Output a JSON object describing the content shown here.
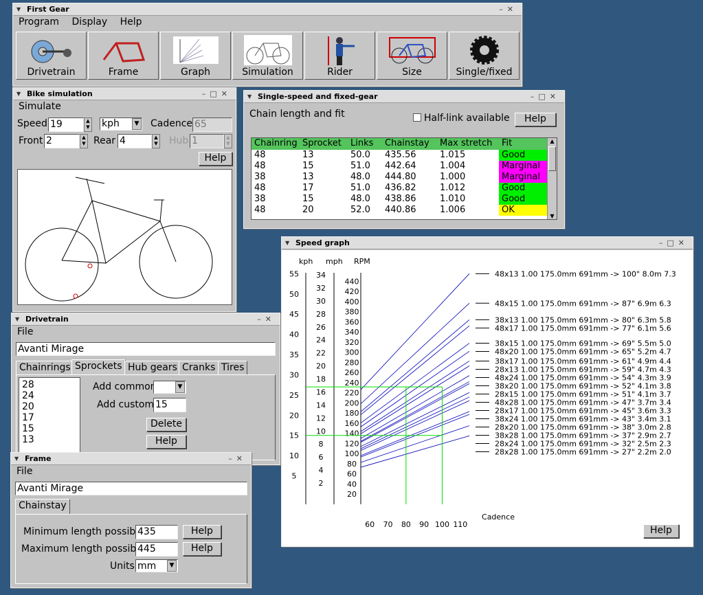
{
  "first_gear": {
    "title": "First Gear",
    "menu": [
      "Program",
      "Display",
      "Help"
    ],
    "toolbar": [
      {
        "label": "Drivetrain",
        "icon": "drivetrain-icon"
      },
      {
        "label": "Frame",
        "icon": "frame-icon"
      },
      {
        "label": "Graph",
        "icon": "graph-icon"
      },
      {
        "label": "Simulation",
        "icon": "simulation-icon"
      },
      {
        "label": "Rider",
        "icon": "rider-icon"
      },
      {
        "label": "Size",
        "icon": "size-icon"
      },
      {
        "label": "Single/fixed",
        "icon": "gear-icon"
      }
    ]
  },
  "bike_sim": {
    "title": "Bike simulation",
    "menu": "Simulate",
    "speed_label": "Speed",
    "speed": "19",
    "unit": "kph",
    "cadence_label": "Cadence",
    "cadence": "65",
    "front_label": "Front",
    "front": "2",
    "rear_label": "Rear",
    "rear": "4",
    "hub_label": "Hub",
    "hub": "1",
    "help": "Help"
  },
  "single_speed": {
    "title": "Single-speed and fixed-gear",
    "subtitle": "Chain length and fit",
    "halflink": "Half-link available",
    "help": "Help",
    "columns": [
      "Chainring",
      "Sprocket",
      "Links",
      "Chainstay",
      "Max stretch",
      "Fit"
    ],
    "rows": [
      [
        "48",
        "13",
        "50.0",
        "435.56",
        "1.015",
        "Good"
      ],
      [
        "48",
        "15",
        "51.0",
        "442.64",
        "1.004",
        "Marginal"
      ],
      [
        "38",
        "13",
        "48.0",
        "444.80",
        "1.000",
        "Marginal"
      ],
      [
        "48",
        "17",
        "51.0",
        "436.82",
        "1.012",
        "Good"
      ],
      [
        "38",
        "15",
        "48.0",
        "438.86",
        "1.010",
        "Good"
      ],
      [
        "48",
        "20",
        "52.0",
        "440.86",
        "1.006",
        "OK"
      ]
    ],
    "fit_colors": {
      "Good": "#00ee00",
      "Marginal": "#ff00ff",
      "OK": "#ffff00"
    }
  },
  "drivetrain": {
    "title": "Drivetrain",
    "menu": "File",
    "name": "Avanti Mirage",
    "tabs": [
      "Chainrings",
      "Sprockets",
      "Hub gears",
      "Cranks",
      "Tires"
    ],
    "active_tab": "Sprockets",
    "sprockets": [
      "28",
      "24",
      "20",
      "17",
      "15",
      "13"
    ],
    "add_common": "Add common",
    "add_custom": "Add custom",
    "custom_value": "15",
    "delete": "Delete",
    "help": "Help"
  },
  "frame": {
    "title": "Frame",
    "menu": "File",
    "name": "Avanti Mirage",
    "tab": "Chainstay",
    "min_label": "Minimum length possible",
    "min": "435",
    "max_label": "Maximum length possible",
    "max": "445",
    "units_label": "Units",
    "units": "mm",
    "help": "Help"
  },
  "speed_graph": {
    "title": "Speed graph",
    "axis_kph": "kph",
    "axis_mph": "mph",
    "axis_rpm": "RPM",
    "xlabel": "Cadence",
    "help": "Help",
    "kph_ticks": [
      "55",
      "50",
      "45",
      "40",
      "35",
      "30",
      "25",
      "20",
      "15",
      "10",
      "5"
    ],
    "mph_ticks": [
      "34",
      "32",
      "30",
      "28",
      "26",
      "24",
      "22",
      "20",
      "18",
      "16",
      "14",
      "12",
      "10",
      "8",
      "6",
      "4",
      "2"
    ],
    "rpm_ticks": [
      "440",
      "420",
      "400",
      "380",
      "360",
      "340",
      "320",
      "300",
      "280",
      "260",
      "240",
      "220",
      "200",
      "180",
      "160",
      "140",
      "120",
      "100",
      "80",
      "60",
      "40",
      "20"
    ],
    "cadence_ticks": [
      "60",
      "70",
      "80",
      "90",
      "100",
      "110"
    ]
  },
  "chart_data": {
    "type": "line",
    "xlabel": "Cadence",
    "xlim": [
      55,
      115
    ],
    "ylim_kph": [
      0,
      60
    ],
    "series": [
      {
        "name": "48x13 1.00 175.0mm 691mm -> 100\" 8.0m 7.3",
        "gear": "48x13",
        "kph_at_115": 55.0
      },
      {
        "name": "48x15 1.00 175.0mm 691mm -> 87\" 6.9m 6.3",
        "gear": "48x15",
        "kph_at_115": 47.7
      },
      {
        "name": "38x13 1.00 175.0mm 691mm -> 80\" 6.3m 5.8",
        "gear": "38x13",
        "kph_at_115": 43.6
      },
      {
        "name": "48x17 1.00 175.0mm 691mm -> 77\" 6.1m 5.6",
        "gear": "48x17",
        "kph_at_115": 42.1
      },
      {
        "name": "38x15 1.00 175.0mm 691mm -> 69\" 5.5m 5.0",
        "gear": "38x15",
        "kph_at_115": 37.8
      },
      {
        "name": "48x20 1.00 175.0mm 691mm -> 65\" 5.2m 4.7",
        "gear": "48x20",
        "kph_at_115": 35.8
      },
      {
        "name": "38x17 1.00 175.0mm 691mm -> 61\" 4.9m 4.4",
        "gear": "38x17",
        "kph_at_115": 33.4
      },
      {
        "name": "28x13 1.00 175.0mm 691mm -> 59\" 4.7m 4.3",
        "gear": "28x13",
        "kph_at_115": 32.2
      },
      {
        "name": "48x24 1.00 175.0mm 691mm -> 54\" 4.3m 3.9",
        "gear": "48x24",
        "kph_at_115": 29.8
      },
      {
        "name": "38x20 1.00 175.0mm 691mm -> 52\" 4.1m 3.8",
        "gear": "38x20",
        "kph_at_115": 28.3
      },
      {
        "name": "28x15 1.00 175.0mm 691mm -> 51\" 4.1m 3.7",
        "gear": "28x15",
        "kph_at_115": 27.8
      },
      {
        "name": "48x28 1.00 175.0mm 691mm -> 47\" 3.7m 3.4",
        "gear": "48x28",
        "kph_at_115": 25.6
      },
      {
        "name": "28x17 1.00 175.0mm 691mm -> 45\" 3.6m 3.3",
        "gear": "28x17",
        "kph_at_115": 24.5
      },
      {
        "name": "38x24 1.00 175.0mm 691mm -> 43\" 3.4m 3.1",
        "gear": "38x24",
        "kph_at_115": 23.6
      },
      {
        "name": "28x20 1.00 175.0mm 691mm -> 38\" 3.0m 2.8",
        "gear": "28x20",
        "kph_at_115": 20.9
      },
      {
        "name": "38x28 1.00 175.0mm 691mm -> 37\" 2.9m 2.7",
        "gear": "38x28",
        "kph_at_115": 20.2
      },
      {
        "name": "28x24 1.00 175.0mm 691mm -> 32\" 2.5m 2.3",
        "gear": "28x24",
        "kph_at_115": 17.4
      },
      {
        "name": "28x28 1.00 175.0mm 691mm -> 27\" 2.2m 2.0",
        "gear": "28x28",
        "kph_at_115": 14.9
      }
    ],
    "markers": {
      "cadence": [
        80,
        100
      ],
      "kph": [
        15,
        27
      ]
    },
    "grid": false,
    "line_color": "#0000bb",
    "marker_color": "#00dd00"
  }
}
